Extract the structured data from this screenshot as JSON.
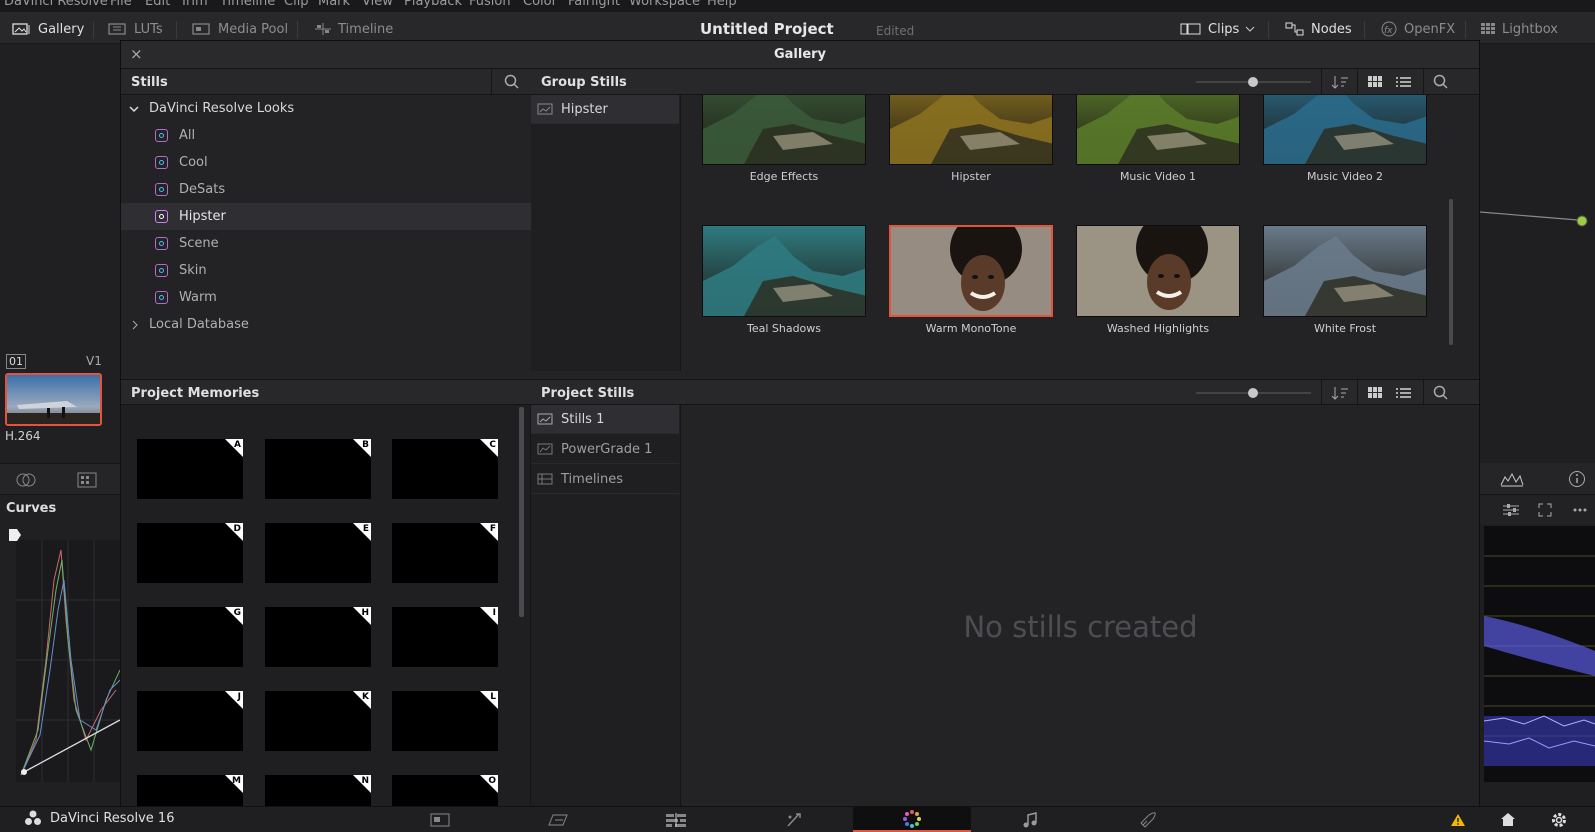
{
  "menubar": {
    "items": [
      "DaVinci Resolve",
      "File",
      "Edit",
      "Trim",
      "Timeline",
      "Clip",
      "Mark",
      "View",
      "Playback",
      "Fusion",
      "Color",
      "Fairlight",
      "Workspace",
      "Help"
    ]
  },
  "toolbar": {
    "gallery": "Gallery",
    "luts": "LUTs",
    "media_pool": "Media Pool",
    "timeline": "Timeline",
    "project_title": "Untitled Project",
    "project_status": "Edited",
    "clips": "Clips",
    "nodes": "Nodes",
    "openfx": "OpenFX",
    "lightbox": "Lightbox"
  },
  "gallery": {
    "title": "Gallery",
    "stills_title": "Stills",
    "tree": {
      "root": "DaVinci Resolve Looks",
      "looks": [
        "All",
        "Cool",
        "DeSats",
        "Hipster",
        "Scene",
        "Skin",
        "Warm"
      ],
      "selected": "Hipster",
      "local_db": "Local Database"
    },
    "group_stills": {
      "title": "Group Stills",
      "album": "Hipster",
      "stills": [
        {
          "label": "Edge Effects",
          "kind": "mountain",
          "tint": "#3a5a3a"
        },
        {
          "label": "Hipster",
          "kind": "mountain",
          "tint": "#8a7020"
        },
        {
          "label": "Music Video 1",
          "kind": "mountain",
          "tint": "#5a7a2a"
        },
        {
          "label": "Music Video 2",
          "kind": "mountain",
          "tint": "#2a6a8a"
        },
        {
          "label": "Teal Shadows",
          "kind": "mountain",
          "tint": "#2f7a80"
        },
        {
          "label": "Warm MonoTone",
          "kind": "portrait",
          "tint": "#8a6a50"
        },
        {
          "label": "Washed Highlights",
          "kind": "portrait",
          "tint": "#9a8a60"
        },
        {
          "label": "White Frost",
          "kind": "mountain",
          "tint": "#6a7a8a"
        }
      ],
      "selected_index": 5
    },
    "project_memories": {
      "title": "Project Memories",
      "slots": [
        "A",
        "B",
        "C",
        "D",
        "E",
        "F",
        "G",
        "H",
        "I",
        "J",
        "K",
        "L",
        "M",
        "N",
        "O"
      ]
    },
    "project_stills": {
      "title": "Project Stills",
      "albums": [
        "Stills 1",
        "PowerGrade 1",
        "Timelines"
      ],
      "selected": "Stills 1",
      "empty_text": "No stills created"
    }
  },
  "background": {
    "clip_number": "01",
    "clip_track": "V1",
    "clip_codec": "H.264",
    "curves_title": "Curves"
  },
  "bottombar": {
    "brand": "DaVinci Resolve 16",
    "pages": [
      "media",
      "cut",
      "edit",
      "fusion",
      "color",
      "fairlight",
      "deliver"
    ],
    "active_page": "color"
  },
  "colors": {
    "accent": "#e2543c",
    "panel": "#232326",
    "text": "#b8b8b8"
  }
}
